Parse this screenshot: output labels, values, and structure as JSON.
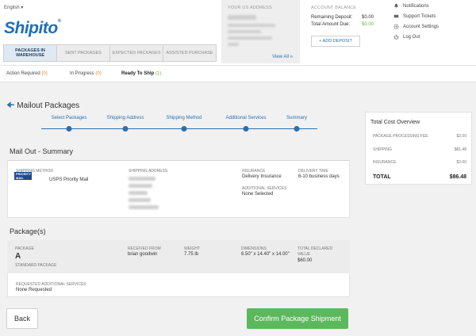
{
  "header": {
    "language": "English ▾",
    "logo": "Shipito",
    "tabs": [
      {
        "label": "PACKAGES IN WAREHOUSE",
        "active": true
      },
      {
        "label": "SENT PACKAGES",
        "active": false
      },
      {
        "label": "EXPECTED PACKAGES",
        "active": false
      },
      {
        "label": "ASSISTED PURCHASE",
        "active": false
      }
    ],
    "us_address_label": "YOUR US ADDRESS",
    "view_all": "View All »",
    "account_balance_label": "ACCOUNT BALANCE",
    "remaining_deposit_label": "Remaining Deposit:",
    "remaining_deposit_value": "$0.00",
    "total_due_label": "Total Amount Due:",
    "total_due_value": "$0.00",
    "add_deposit": "+ ADD DEPOSIT",
    "links": [
      {
        "label": "Notifications",
        "icon": "bell-icon"
      },
      {
        "label": "Support Tickets",
        "icon": "ticket-icon"
      },
      {
        "label": "Account Settings",
        "icon": "gear-icon"
      },
      {
        "label": "Log Out",
        "icon": "power-icon"
      }
    ]
  },
  "subnav": {
    "action_required": "Action Required",
    "action_required_count": "(0)",
    "in_progress": "In Progress",
    "in_progress_count": "(0)",
    "ready_to_ship": "Ready To Ship",
    "ready_to_ship_count": "(1)"
  },
  "page_title": "Mailout Packages",
  "steps": [
    "Select Packages",
    "Shipping Address",
    "Shipping Method",
    "Additional Services",
    "Summary"
  ],
  "summary": {
    "title": "Mail Out - Summary",
    "shipping_method_label": "SHIPPING METHOD",
    "shipping_method_value": "USPS Priority Mail",
    "usps_logo_text": "PRIORITY MAIL",
    "shipping_address_label": "SHIPPING ADDRESS",
    "insurance_label": "INSURANCE",
    "insurance_value": "Delivery Insurance",
    "delivery_time_label": "DELIVERY TIME",
    "delivery_time_value": "6-10 business days",
    "additional_services_label": "ADDITIONAL SERVICES",
    "additional_services_value": "None Selected"
  },
  "packages": {
    "title": "Package(s)",
    "package_label": "PACKAGE",
    "package_value": "A",
    "package_type": "STANDARD PACKAGE",
    "received_from_label": "RECEIVED FROM",
    "received_from_value": "brian goodwin",
    "weight_label": "WEIGHT",
    "weight_value": "7.75 lb",
    "dimensions_label": "DIMENSIONS",
    "dimensions_value": "6.50\" x 14.40\" x 14.00\"",
    "declared_label": "TOTAL DECLARED VALUE",
    "declared_value": "$60.00",
    "requested_label": "REQUESTED ADDITIONAL SERVICES",
    "requested_value": "None Requested"
  },
  "buttons": {
    "back": "Back",
    "confirm": "Confirm Package Shipment"
  },
  "cost": {
    "title": "Total Cost Overview",
    "rows": [
      {
        "label": "PACKAGE PROCESSING FEE",
        "value": "$2.00"
      },
      {
        "label": "SHIPPING",
        "value": "$81.48"
      },
      {
        "label": "INSURANCE",
        "value": "$3.00"
      }
    ],
    "total_label": "TOTAL",
    "total_value": "$86.48"
  },
  "colors": {
    "accent": "#2a6fb0",
    "confirm": "#5cb85c",
    "orange": "#e08a2a",
    "green": "#6bb33e"
  }
}
